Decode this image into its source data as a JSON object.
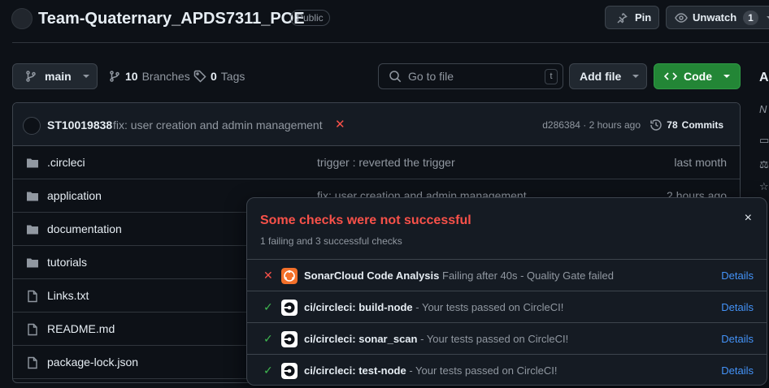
{
  "repo": {
    "name": "Team-Quaternary_APDS7311_POE",
    "visibility": "Public",
    "pin_label": "Pin",
    "watch_label": "Unwatch",
    "watch_count": "1"
  },
  "toolbar": {
    "branch": "main",
    "branches_count": "10",
    "branches_label": "Branches",
    "tags_count": "0",
    "tags_label": "Tags",
    "search_placeholder": "Go to file",
    "search_shortcut": "t",
    "add_file_label": "Add file",
    "code_label": "Code"
  },
  "commit": {
    "author": "ST10019838",
    "message": "fix: user creation and admin management",
    "status": "✕",
    "hash_time": "d286384 · 2 hours ago",
    "commits_count": "78",
    "commits_label": "Commits"
  },
  "files": [
    {
      "type": "folder",
      "name": ".circleci",
      "message": "trigger : reverted the trigger",
      "time": "last month"
    },
    {
      "type": "folder",
      "name": "application",
      "message": "fix: user creation and admin management",
      "time": "2 hours ago"
    },
    {
      "type": "folder",
      "name": "documentation",
      "message": "",
      "time": ""
    },
    {
      "type": "folder",
      "name": "tutorials",
      "message": "",
      "time": ""
    },
    {
      "type": "file",
      "name": "Links.txt",
      "message": "",
      "time": ""
    },
    {
      "type": "file",
      "name": "README.md",
      "message": "",
      "time": ""
    },
    {
      "type": "file",
      "name": "package-lock.json",
      "message": "",
      "time": ""
    }
  ],
  "sidebar_peek": {
    "heading": "A",
    "line": "N"
  },
  "checks_popover": {
    "title": "Some checks were not successful",
    "subtitle": "1 failing and 3 successful checks",
    "close": "×",
    "checks": [
      {
        "status": "fail",
        "status_glyph": "✕",
        "app": "sonarcloud-icon",
        "name": "SonarCloud Code Analysis",
        "description": "Failing after 40s - Quality Gate failed",
        "details": "Details"
      },
      {
        "status": "ok",
        "status_glyph": "✓",
        "app": "circleci-icon",
        "name": "ci/circleci: build-node",
        "description": "- Your tests passed on CircleCI!",
        "details": "Details"
      },
      {
        "status": "ok",
        "status_glyph": "✓",
        "app": "circleci-icon",
        "name": "ci/circleci: sonar_scan",
        "description": "- Your tests passed on CircleCI!",
        "details": "Details"
      },
      {
        "status": "ok",
        "status_glyph": "✓",
        "app": "circleci-icon",
        "name": "ci/circleci: test-node",
        "description": "- Your tests passed on CircleCI!",
        "details": "Details"
      }
    ]
  },
  "colors": {
    "background": "#0d1117",
    "accent_green": "#238636",
    "fail_red": "#f85149",
    "success_green": "#3fb950",
    "link_blue": "#4493f8"
  }
}
